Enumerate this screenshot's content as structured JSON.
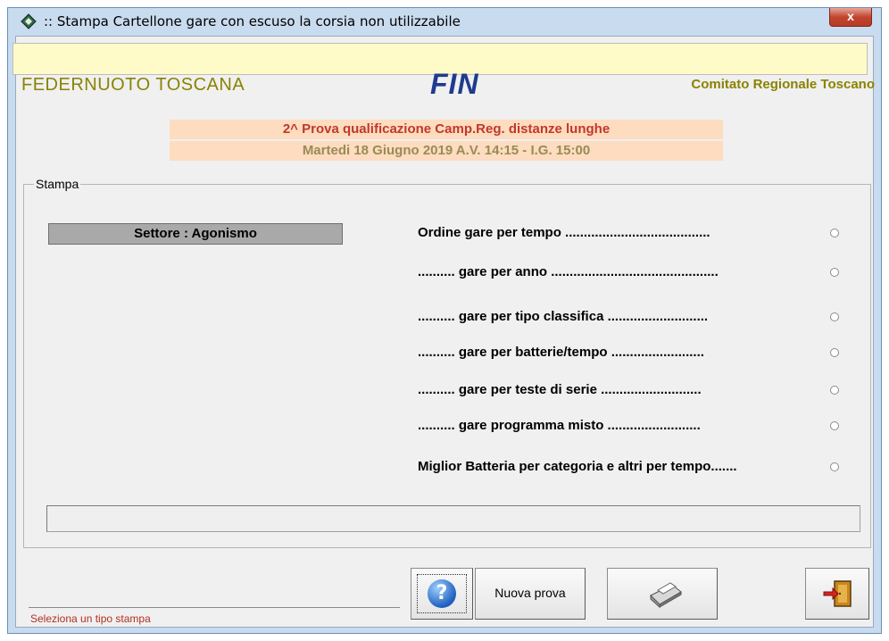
{
  "window": {
    "title": ":: Stampa Cartellone gare con escuso la corsia non utilizzabile",
    "close_label": "x"
  },
  "header": {
    "org": "FEDERNUOTO TOSCANA",
    "logo": "FIN",
    "comitato": "Comitato Regionale Toscano"
  },
  "event": {
    "title": "2^ Prova qualificazione Camp.Reg. distanze lunghe",
    "date": "Martedi 18 Giugno 2019 A.V. 14:15 - I.G. 15:00"
  },
  "stampa": {
    "group_label": "Stampa",
    "settore": "Settore : Agonismo",
    "options": [
      {
        "label": "Ordine  gare per tempo .......................................",
        "selected": false
      },
      {
        "label": ".......... gare per anno .............................................",
        "selected": false
      },
      {
        "label": ".......... gare per tipo classifica ...........................",
        "selected": false
      },
      {
        "label": ".......... gare per batterie/tempo .........................",
        "selected": false
      },
      {
        "label": ".......... gare per teste di serie ...........................",
        "selected": false
      },
      {
        "label": ".......... gare programma misto .........................",
        "selected": false
      },
      {
        "label": "Miglior Batteria per categoria e altri per tempo.......",
        "selected": false
      }
    ]
  },
  "status": {
    "message": "Seleziona un tipo stampa"
  },
  "buttons": {
    "help_icon": "?",
    "nuova_prova": "Nuova prova",
    "print_icon": "printer-icon",
    "exit_icon": "exit-door-icon"
  }
}
